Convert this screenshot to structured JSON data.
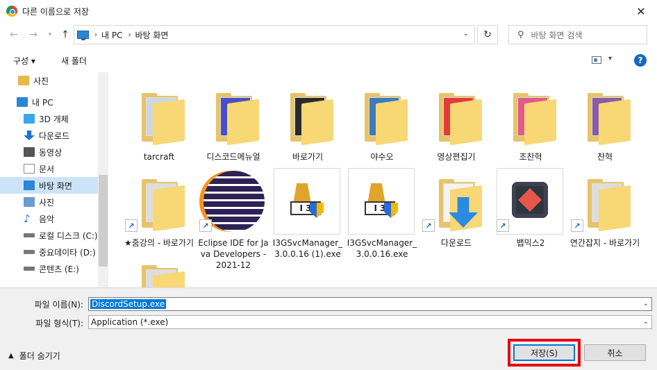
{
  "window": {
    "title": "다른 이름으로 저장",
    "close_label": "✕"
  },
  "nav": {
    "address_segments": [
      "내 PC",
      "바탕 화면"
    ],
    "search_placeholder": "바탕 화면 검색"
  },
  "toolbar": {
    "organize_label": "구성 ▾",
    "new_folder_label": "새 폴더",
    "help_label": "?"
  },
  "sidebar": {
    "items": [
      {
        "label": "사진",
        "icon": "pictures-icon",
        "color": "#e8b84a"
      },
      {
        "label": "내 PC",
        "icon": "pc-icon",
        "color": "#2a86d6"
      },
      {
        "label": "3D 개체",
        "icon": "3d-objects-icon",
        "color": "#3aa6e8"
      },
      {
        "label": "다운로드",
        "icon": "download-arrow-icon",
        "color": "#1e73d2"
      },
      {
        "label": "동영상",
        "icon": "video-icon",
        "color": "#555555"
      },
      {
        "label": "문서",
        "icon": "document-icon",
        "color": "#8a8a8a"
      },
      {
        "label": "바탕 화면",
        "icon": "desktop-icon",
        "color": "#2a86d6",
        "selected": true
      },
      {
        "label": "사진",
        "icon": "pictures-icon",
        "color": "#6a9bd1"
      },
      {
        "label": "음악",
        "icon": "music-icon",
        "color": "#1e73d2"
      },
      {
        "label": "로컬 디스크 (C:)",
        "icon": "drive-icon",
        "color": "#777777"
      },
      {
        "label": "중요데이타 (D:)",
        "icon": "drive-icon",
        "color": "#777777"
      },
      {
        "label": "콘텐츠 (E:)",
        "icon": "drive-icon",
        "color": "#777777"
      }
    ]
  },
  "files": [
    {
      "label": "tarcraft",
      "kind": "folder",
      "paper": "#cfd6dd"
    },
    {
      "label": "디스코드메뉴얼",
      "kind": "folder",
      "paper": "#4a4fc8"
    },
    {
      "label": "바로가기",
      "kind": "folder",
      "paper": "#2a2a2a"
    },
    {
      "label": "야수오",
      "kind": "folder",
      "paper": "#3b7bbf"
    },
    {
      "label": "영상편집기",
      "kind": "folder",
      "paper": "#e33b3b"
    },
    {
      "label": "조찬혁",
      "kind": "folder",
      "paper": "#e05a8a"
    },
    {
      "label": "찬혁",
      "kind": "folder",
      "paper": "#8a5ca8"
    },
    {
      "label": "★줌강의 - 바로가기",
      "kind": "folder-shortcut",
      "paper": "#dddddd"
    },
    {
      "label": "Eclipse IDE for Java Developers - 2021-12",
      "kind": "eclipse-shortcut"
    },
    {
      "label": "I3GSvcManager_3.0.0.16 (1).exe",
      "kind": "exe"
    },
    {
      "label": "I3GSvcManager_3.0.0.16.exe",
      "kind": "exe"
    },
    {
      "label": "다운로드",
      "kind": "download-shortcut"
    },
    {
      "label": "뱁믹스2",
      "kind": "app-shortcut"
    },
    {
      "label": "연간잡지 - 바로가기",
      "kind": "folder-shortcut",
      "paper": "#dddddd"
    },
    {
      "label": "",
      "kind": "folder",
      "paper": "#dddddd"
    }
  ],
  "form": {
    "filename_label": "파일 이름(N):",
    "filename_value": "DiscordSetup.exe",
    "filetype_label": "파일 형식(T):",
    "filetype_value": "Application (*.exe)"
  },
  "footer": {
    "hide_folders_label": "폴더 숨기기",
    "save_label": "저장(S)",
    "cancel_label": "취소"
  }
}
